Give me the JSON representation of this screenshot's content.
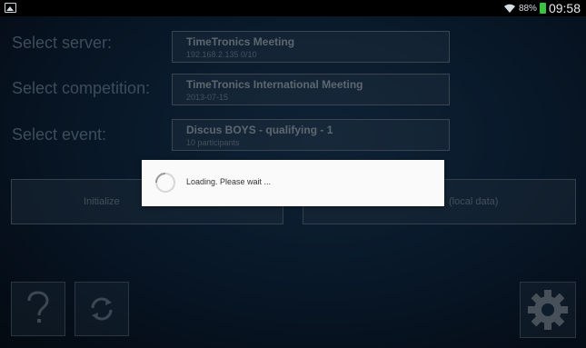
{
  "status_bar": {
    "battery": "88%",
    "time": "09:58",
    "icons": [
      "image-icon",
      "wifi-icon",
      "battery-icon"
    ]
  },
  "form": {
    "server_label": "Select server:",
    "server_title": "TimeTronics Meeting",
    "server_sub": "192.168.2.135    0/10",
    "competition_label": "Select competition:",
    "competition_title": "TimeTronics International Meeting",
    "competition_sub": "2013-07-15",
    "event_label": "Select event:",
    "event_title": "Discus BOYS - qualifying - 1",
    "event_sub": "10 participants"
  },
  "buttons": {
    "initialize_label": "Initialize",
    "local_label": "(local data)",
    "help_icon": "question-icon",
    "refresh_icon": "refresh-icon",
    "settings_icon": "gear-icon"
  },
  "dialog": {
    "message": "Loading. Please wait ..."
  },
  "colors": {
    "background": "#12304f",
    "dialog_bg": "#fafafa",
    "battery": "#39c33e"
  }
}
